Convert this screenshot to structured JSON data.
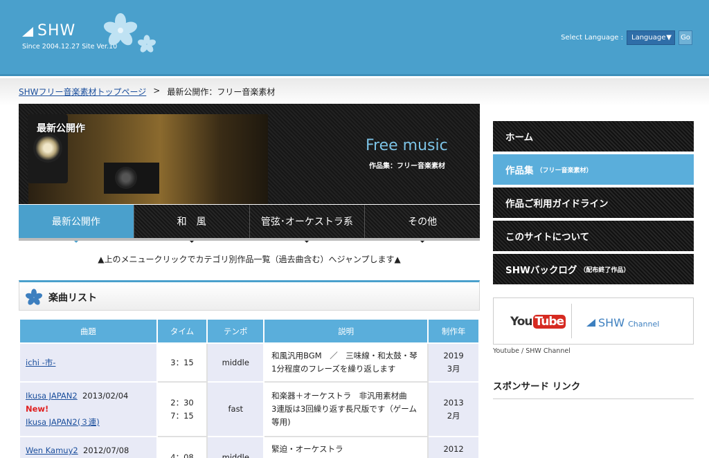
{
  "header": {
    "logo_text": "SHW",
    "logo_sub": "Since 2004.12.27   Site Ver.10",
    "language_label": "Select Language :",
    "language_value": "Language",
    "go_label": "Go"
  },
  "breadcrumb": {
    "home": "SHWフリー音楽素材トップページ",
    "sep": ">",
    "current": "最新公開作：フリー音楽素材"
  },
  "banner": {
    "label": "最新公開作",
    "title": "Free music",
    "subtitle": "作品集：フリー音楽素材"
  },
  "tabs": [
    "最新公開作",
    "和　風",
    "管弦･オーケストラ系",
    "その他"
  ],
  "jump_note": "▲上のメニュークリックでカテゴリ別作品一覧（過去曲含む）へジャンプします▲",
  "section_title": "楽曲リスト",
  "table": {
    "headers": [
      "曲題",
      "タイム",
      "テンポ",
      "説明",
      "制作年"
    ],
    "rows": [
      {
        "title": "ichi -市-",
        "date": "",
        "new": "",
        "title2": "",
        "time1": "3：15",
        "time2": "",
        "tempo": "middle",
        "desc1": "和風汎用BGM　／　三味線・和太鼓・琴",
        "desc2": "1分程度のフレーズを繰り返します",
        "desc3": "",
        "year": "2019",
        "month": "3月"
      },
      {
        "title": "Ikusa JAPAN2",
        "date": "2013/02/04",
        "new": "New!",
        "title2": "Ikusa JAPAN2(３連)",
        "time1": "2：30",
        "time2": "7：15",
        "tempo": "fast",
        "desc1": "和楽器＋オーケストラ　非汎用素材曲",
        "desc2": "3連版は3回繰り返す長尺版です（ゲーム",
        "desc3": "等用)",
        "year": "2013",
        "month": "2月"
      },
      {
        "title": "Wen Kamuy2",
        "date": "2012/07/08",
        "new": "",
        "title2": "",
        "time1": "4：08",
        "time2": "",
        "tempo": "middle",
        "desc1": "緊迫・オーケストラ",
        "desc2": "",
        "desc3": "",
        "year": "2012",
        "month": ""
      }
    ]
  },
  "sidebar": {
    "items": [
      {
        "label": "ホーム",
        "note": ""
      },
      {
        "label": "作品集",
        "note": "（フリー音楽素材）"
      },
      {
        "label": "作品ご利用ガイドライン",
        "note": ""
      },
      {
        "label": "このサイトについて",
        "note": ""
      },
      {
        "label": "SHWバックログ",
        "note": "（配布終了作品）"
      }
    ],
    "youtube_you": "You",
    "youtube_tube": "Tube",
    "shw_channel_name": "SHW",
    "shw_channel_suffix": "Channel",
    "youtube_caption": "Youtube / SHW Channel",
    "sponsor_title": "スポンサード リンク"
  },
  "colors": {
    "header_blue": "#4aa0cc",
    "tab_active": "#4aa0cc",
    "table_header": "#5aaedb",
    "new_red": "#e02020"
  }
}
